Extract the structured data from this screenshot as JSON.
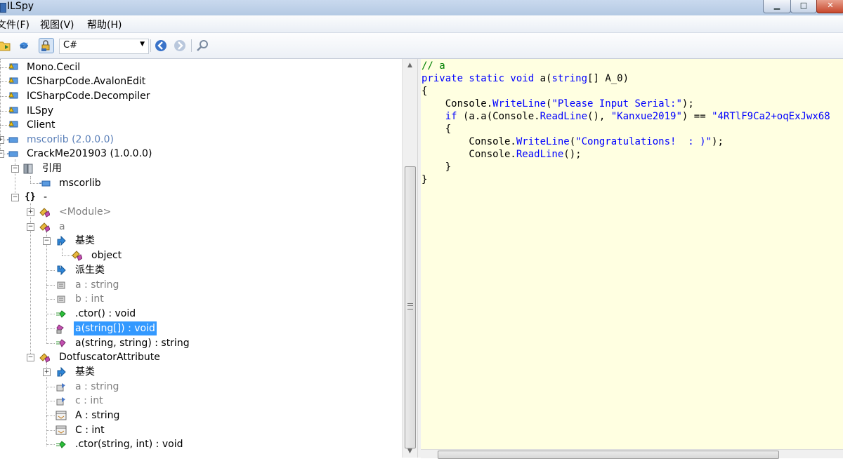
{
  "window": {
    "title": "ILSpy"
  },
  "menu": [
    {
      "label": "文件(F)"
    },
    {
      "label": "视图(V)"
    },
    {
      "label": "帮助(H)"
    }
  ],
  "toolbar": {
    "language": "C#"
  },
  "tree": [
    {
      "label": "Mono.Cecil"
    },
    {
      "label": "ICSharpCode.AvalonEdit"
    },
    {
      "label": "ICSharpCode.Decompiler"
    },
    {
      "label": "ILSpy"
    },
    {
      "label": "Client"
    },
    {
      "label": "mscorlib (2.0.0.0)"
    },
    {
      "label": "CrackMe201903 (1.0.0.0)"
    },
    {
      "label": "引用"
    },
    {
      "label": "mscorlib"
    },
    {
      "label": "-"
    },
    {
      "label": "<Module>"
    },
    {
      "label": "a"
    },
    {
      "label": "基类"
    },
    {
      "label": "object"
    },
    {
      "label": "派生类"
    },
    {
      "label": "a : string"
    },
    {
      "label": "b : int"
    },
    {
      "label": ".ctor() : void"
    },
    {
      "label": "a(string[]) : void"
    },
    {
      "label": "a(string, string) : string"
    },
    {
      "label": "DotfuscatorAttribute"
    },
    {
      "label": "基类"
    },
    {
      "label": "a : string"
    },
    {
      "label": "c : int"
    },
    {
      "label": "A : string"
    },
    {
      "label": "C : int"
    },
    {
      "label": ".ctor(string, int) : void"
    }
  ],
  "code": {
    "l1": "// a",
    "l2_kw": "private static void",
    "l2_name": " a(",
    "l2_type": "string",
    "l2_rest": "[] A_0)",
    "l3": "{",
    "l4_a": "    Console.",
    "l4_b": "WriteLine",
    "l4_c": "(",
    "l4_s": "\"Please Input Serial:\"",
    "l4_d": ");",
    "l5_if": "    if",
    "l5_a": " (a.a(Console.",
    "l5_b": "ReadLine",
    "l5_c": "(), ",
    "l5_s": "\"Kanxue2019\"",
    "l5_d": ") == ",
    "l5_s2": "\"4RTlF9Ca2+oqExJwx68",
    "l6": "    {",
    "l7_a": "        Console.",
    "l7_b": "WriteLine",
    "l7_c": "(",
    "l7_s": "\"Congratulations!  : )\"",
    "l7_d": ");",
    "l8_a": "        Console.",
    "l8_b": "ReadLine",
    "l8_c": "();",
    "l9": "    }",
    "l10": "}"
  },
  "colors": {
    "selection": "#3399ff",
    "code_bg": "#ffffe1",
    "keyword": "#0000ff",
    "comment": "#008000",
    "string": "#a31515"
  }
}
